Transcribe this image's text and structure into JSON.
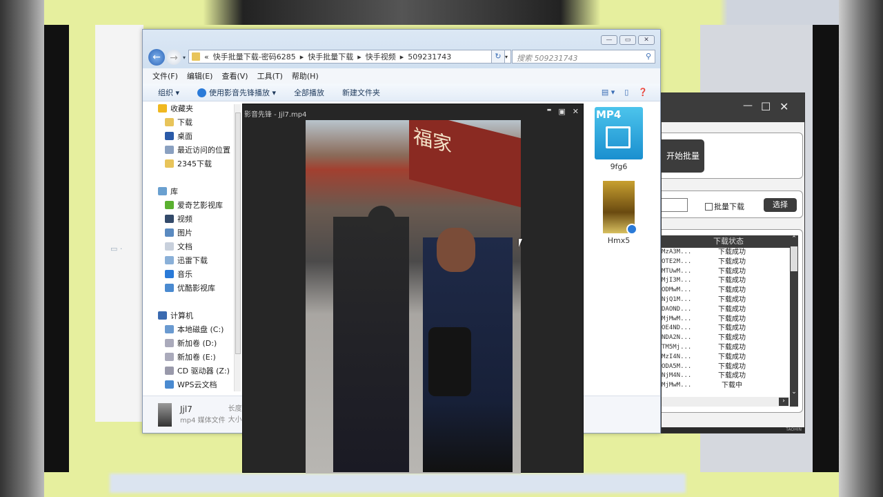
{
  "explorer": {
    "window_buttons": [
      "—",
      "▭",
      "✕"
    ],
    "breadcrumb": [
      "«",
      "快手批量下载-密码6285",
      "快手批量下载",
      "快手视频",
      "509231743"
    ],
    "search_placeholder": "搜索 509231743",
    "menu": [
      "文件(F)",
      "编辑(E)",
      "查看(V)",
      "工具(T)",
      "帮助(H)"
    ],
    "toolbar": {
      "organize": "组织 ▾",
      "play_with": "使用影音先锋播放 ▾",
      "play_all": "全部播放",
      "new_folder": "新建文件夹"
    },
    "sidebar": [
      {
        "label": "收藏夹",
        "icon": "star-icon",
        "header": true,
        "color": "#f0b820"
      },
      {
        "label": "下载",
        "icon": "download-folder-icon",
        "color": "#e8c45a"
      },
      {
        "label": "桌面",
        "icon": "desktop-icon",
        "color": "#2a5aa8"
      },
      {
        "label": "最近访问的位置",
        "icon": "recent-places-icon",
        "color": "#8aa0c0"
      },
      {
        "label": "2345下载",
        "icon": "folder-icon",
        "color": "#e8c45a"
      },
      {
        "gap": true
      },
      {
        "label": "库",
        "icon": "library-icon",
        "header": true,
        "color": "#6aa0d0"
      },
      {
        "label": "爱奇艺影视库",
        "icon": "iqiyi-icon",
        "color": "#5ab030"
      },
      {
        "label": "视频",
        "icon": "video-library-icon",
        "color": "#334a6a"
      },
      {
        "label": "图片",
        "icon": "pictures-icon",
        "color": "#5a8ac0"
      },
      {
        "label": "文档",
        "icon": "documents-icon",
        "color": "#c8d0dc"
      },
      {
        "label": "迅雷下载",
        "icon": "thunder-download-icon",
        "color": "#8ab0d8"
      },
      {
        "label": "音乐",
        "icon": "music-icon",
        "color": "#2a7ad8"
      },
      {
        "label": "优酷影视库",
        "icon": "youku-icon",
        "color": "#4a8ad0"
      },
      {
        "gap": true
      },
      {
        "label": "计算机",
        "icon": "computer-icon",
        "header": true,
        "color": "#3a6ab0"
      },
      {
        "label": "本地磁盘 (C:)",
        "icon": "drive-c-icon",
        "color": "#6a9ad0"
      },
      {
        "label": "新加卷 (D:)",
        "icon": "drive-icon",
        "color": "#aab"
      },
      {
        "label": "新加卷 (E:)",
        "icon": "drive-icon",
        "color": "#aab"
      },
      {
        "label": "CD 驱动器 (Z:)",
        "icon": "cd-drive-icon",
        "color": "#99a"
      },
      {
        "label": "WPS云文档",
        "icon": "cloud-icon",
        "color": "#4a8ad0"
      }
    ],
    "files": [
      {
        "name": "9fg6",
        "type": "mp4-icon"
      },
      {
        "name": "Hmx5",
        "type": "video-thumbnail"
      }
    ],
    "details": {
      "name": "Jjl7",
      "type": "mp4 媒体文件",
      "length_label": "长度",
      "size_label": "大小"
    }
  },
  "player": {
    "title": "影音先锋 - Jjl7.mp4",
    "buttons": [
      "▬",
      "▣",
      "✕"
    ],
    "sign_text": "福家"
  },
  "downloader": {
    "window_buttons": [
      "—",
      "☐",
      "✕"
    ],
    "start_button": "开始批量",
    "batch_checkbox": "批量下载",
    "batch_checked": false,
    "select_button": "选择",
    "column_status": "下载状态",
    "rows": [
      [
        "MzA3M...",
        "下载成功"
      ],
      [
        "OTE2M...",
        "下载成功"
      ],
      [
        "MTUwM...",
        "下载成功"
      ],
      [
        "MjI3M...",
        "下载成功"
      ],
      [
        "ODMwM...",
        "下载成功"
      ],
      [
        "NjQ1M...",
        "下载成功"
      ],
      [
        "DAOND...",
        "下载成功"
      ],
      [
        "MjMwM...",
        "下载成功"
      ],
      [
        "OE4ND...",
        "下载成功"
      ],
      [
        "NDA2N...",
        "下载成功"
      ],
      [
        "TM5Mj...",
        "下载成功"
      ],
      [
        "MzI4N...",
        "下载成功"
      ],
      [
        "ODA5M...",
        "下载成功"
      ],
      [
        "NjM4N...",
        "下载成功"
      ],
      [
        "MjMwM...",
        "下载中"
      ]
    ],
    "footer": "TAOHIN"
  }
}
